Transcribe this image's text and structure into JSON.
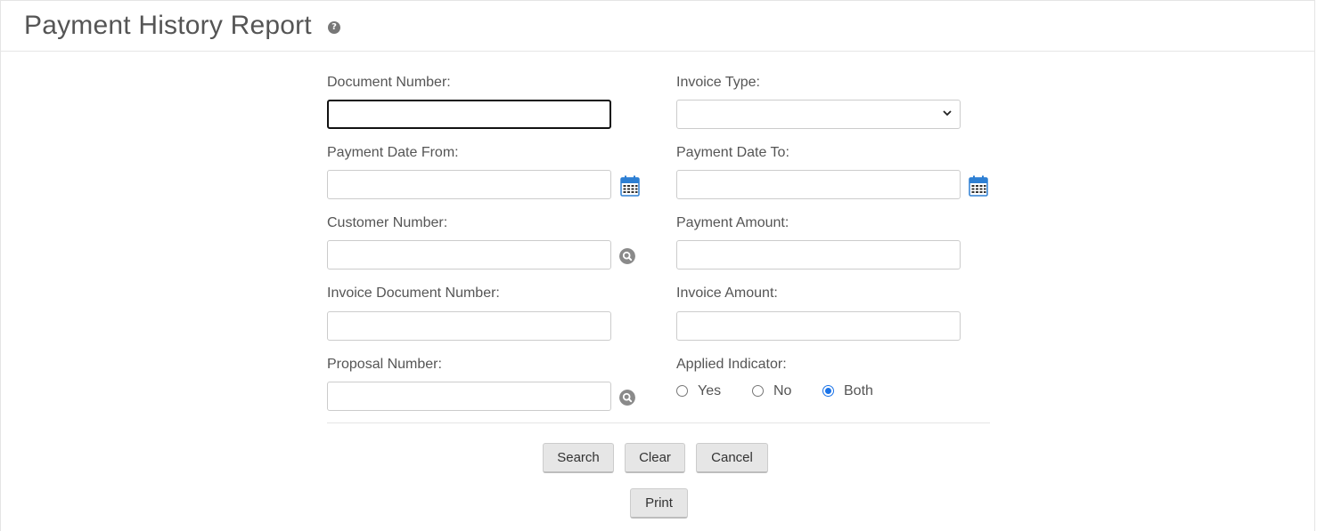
{
  "header": {
    "title": "Payment History Report",
    "help_icon": "question-circle-icon",
    "help_glyph": "?"
  },
  "form": {
    "document_number": {
      "label": "Document Number:",
      "value": ""
    },
    "invoice_type": {
      "label": "Invoice Type:",
      "selected": ""
    },
    "payment_date_from": {
      "label": "Payment Date From:",
      "value": ""
    },
    "payment_date_to": {
      "label": "Payment Date To:",
      "value": ""
    },
    "customer_number": {
      "label": "Customer Number:",
      "value": ""
    },
    "payment_amount": {
      "label": "Payment Amount:",
      "value": ""
    },
    "invoice_document_number": {
      "label": "Invoice Document Number:",
      "value": ""
    },
    "invoice_amount": {
      "label": "Invoice Amount:",
      "value": ""
    },
    "proposal_number": {
      "label": "Proposal Number:",
      "value": ""
    },
    "applied_indicator": {
      "label": "Applied Indicator:",
      "options": [
        "Yes",
        "No",
        "Both"
      ],
      "selected": "Both"
    }
  },
  "buttons": {
    "search": "Search",
    "clear": "Clear",
    "cancel": "Cancel",
    "print": "Print"
  },
  "colors": {
    "calendar_blue": "#2d7fd3",
    "radio_accent": "#1a73e8",
    "button_bg": "#e6e6e6",
    "lookup_gray": "#8a8a8a"
  }
}
